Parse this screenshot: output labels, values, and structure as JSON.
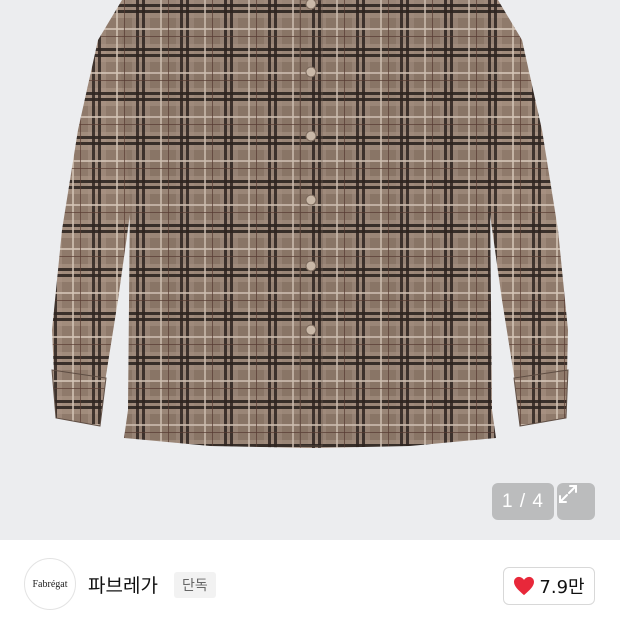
{
  "gallery": {
    "image_alt": "plaid shirt product photo",
    "counter": "1 / 4",
    "expand_icon": "expand-icon",
    "colors": {
      "background": "#ecedef",
      "shirt_base": "#8f7a6b",
      "shirt_dark": "#3d302a",
      "shirt_light": "#c7b8aa"
    }
  },
  "brand": {
    "logo_text": "Fabrégat",
    "name": "파브레가",
    "badge": "단독"
  },
  "like": {
    "icon": "heart-icon",
    "count": "7.9만",
    "color": "#e8283a"
  }
}
